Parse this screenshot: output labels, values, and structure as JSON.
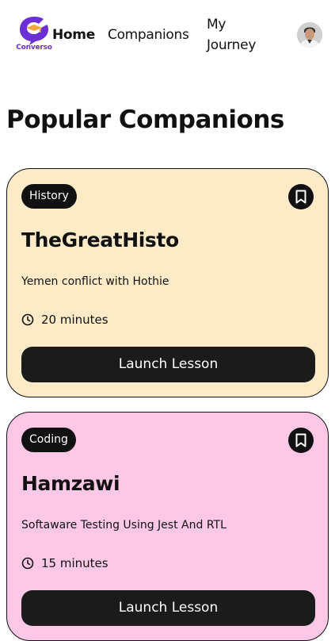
{
  "nav": {
    "logo_text": "Converso",
    "links": [
      {
        "label": "Home"
      },
      {
        "label": "Companions"
      },
      {
        "label": "My Journey"
      }
    ]
  },
  "page": {
    "title": "Popular Companions"
  },
  "companions": [
    {
      "subject": "History",
      "name": "TheGreatHisto",
      "topic": "Yemen conflict with Hothie",
      "duration": "20 minutes",
      "button_label": "Launch Lesson",
      "color": "#fdebc8"
    },
    {
      "subject": "Coding",
      "name": "Hamzawi",
      "topic": "Softaware Testing Using Jest And RTL",
      "duration": "15 minutes",
      "button_label": "Launch Lesson",
      "color": "#fdc8e6"
    }
  ],
  "colors": {
    "brand": "#6b2fd6",
    "brand_accent": "#f2a541",
    "dark": "#111111"
  }
}
